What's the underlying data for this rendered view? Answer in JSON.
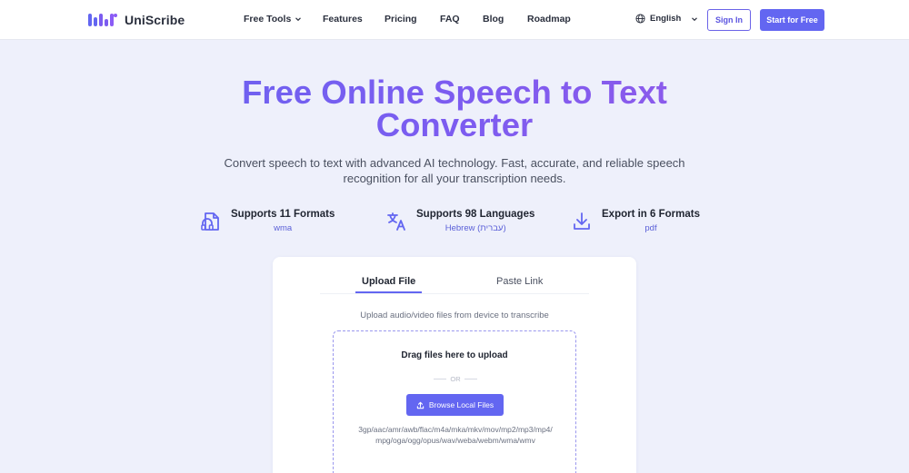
{
  "brand": {
    "name": "UniScribe"
  },
  "nav": {
    "items": [
      {
        "label": "Free Tools",
        "has_dropdown": true
      },
      {
        "label": "Features"
      },
      {
        "label": "Pricing"
      },
      {
        "label": "FAQ"
      },
      {
        "label": "Blog"
      },
      {
        "label": "Roadmap"
      }
    ],
    "language": "English",
    "sign_in": "Sign In",
    "start_free": "Start for Free"
  },
  "hero": {
    "title_line1": "Free Online Speech to Text",
    "title_line2": "Converter",
    "subtitle": "Convert speech to text with advanced AI technology. Fast, accurate, and reliable speech recognition for all your transcription needs."
  },
  "features": [
    {
      "icon": "headphones-file-icon",
      "title": "Supports 11 Formats",
      "value": "wma"
    },
    {
      "icon": "translate-icon",
      "title": "Supports 98 Languages",
      "value": "Hebrew (עברית)"
    },
    {
      "icon": "download-icon",
      "title": "Export in 6 Formats",
      "value": "pdf"
    }
  ],
  "upload_card": {
    "tabs": [
      {
        "label": "Upload File",
        "active": true
      },
      {
        "label": "Paste Link",
        "active": false
      }
    ],
    "description": "Upload audio/video files from device to transcribe",
    "drop_title": "Drag files here to upload",
    "or_text": "OR",
    "browse_label": "Browse Local Files",
    "formats": "3gp/aac/amr/awb/flac/m4a/mka/mkv/mov/mp2/mp3/mp4/mpg/oga/ogg/opus/wav/weba/webm/wma/wmv"
  },
  "colors": {
    "accent": "#6366f1",
    "background": "#eef0fb"
  }
}
